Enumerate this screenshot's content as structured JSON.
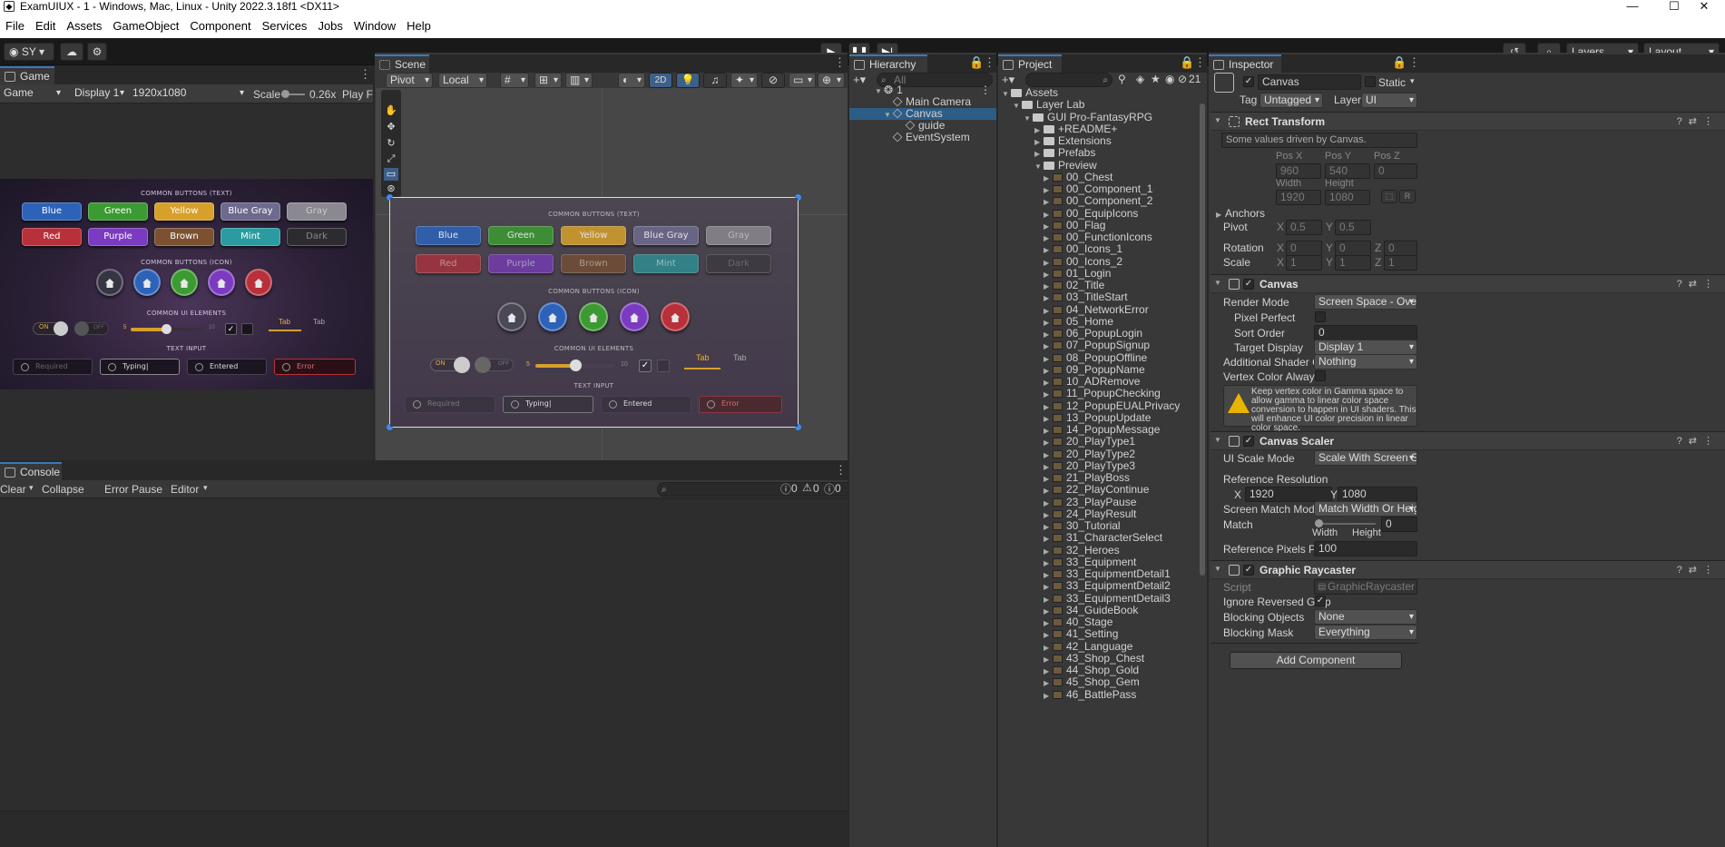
{
  "window": {
    "title": "ExamUIUX - 1 - Windows, Mac, Linux - Unity 2022.3.18f1 <DX11>"
  },
  "menu": [
    "File",
    "Edit",
    "Assets",
    "GameObject",
    "Component",
    "Services",
    "Jobs",
    "Window",
    "Help"
  ],
  "toolbar": {
    "account": "SY",
    "layers": "Layers",
    "layout": "Layout"
  },
  "game": {
    "tab": "Game",
    "mode": "Game",
    "display": "Display 1",
    "resolution": "1920x1080",
    "scale_label": "Scale",
    "scale_value": "0.26x",
    "play_focused": "Play Fc"
  },
  "scene": {
    "tab": "Scene",
    "pivot": "Pivot",
    "local": "Local",
    "mode2d": "2D"
  },
  "ui_canvas": {
    "sec_text": "COMMON BUTTONS (TEXT)",
    "sec_icon": "COMMON BUTTONS (ICON)",
    "sec_elements": "COMMON UI ELEMENTS",
    "sec_input": "TEXT INPUT",
    "buttons_row1": [
      "Blue",
      "Green",
      "Yellow",
      "Blue Gray",
      "Gray"
    ],
    "buttons_row2": [
      "Red",
      "Purple",
      "Brown",
      "Mint",
      "Dark"
    ],
    "toggle_on": "ON",
    "toggle_off": "OFF",
    "slider_min": "5",
    "slider_max": "10",
    "tab_a": "Tab",
    "tab_b": "Tab",
    "inputs": [
      "Required",
      "Typing|",
      "Entered",
      "Error"
    ]
  },
  "hierarchy": {
    "tab": "Hierarchy",
    "search_placeholder": "All",
    "items": [
      {
        "label": "1",
        "depth": 0
      },
      {
        "label": "Main Camera",
        "depth": 1
      },
      {
        "label": "Canvas",
        "depth": 1
      },
      {
        "label": "guide",
        "depth": 2
      },
      {
        "label": "EventSystem",
        "depth": 1
      }
    ]
  },
  "project": {
    "tab": "Project",
    "count": "21",
    "folders": [
      {
        "label": "Assets",
        "depth": 0
      },
      {
        "label": "Layer Lab",
        "depth": 1
      },
      {
        "label": "GUI Pro-FantasyRPG",
        "depth": 2
      },
      {
        "label": "+README+",
        "depth": 3
      },
      {
        "label": "Extensions",
        "depth": 3
      },
      {
        "label": "Prefabs",
        "depth": 3
      },
      {
        "label": "Preview",
        "depth": 3
      }
    ],
    "previews": [
      "00_Chest",
      "00_Component_1",
      "00_Component_2",
      "00_EquipIcons",
      "00_Flag",
      "00_FunctionIcons",
      "00_Icons_1",
      "00_Icons_2",
      "01_Login",
      "02_Title",
      "03_TitleStart",
      "04_NetworkError",
      "05_Home",
      "06_PopupLogin",
      "07_PopupSignup",
      "08_PopupOffline",
      "09_PopupName",
      "10_ADRemove",
      "11_PopupChecking",
      "12_PopupEUALPrivacy",
      "13_PopupUpdate",
      "14_PopupMessage",
      "20_PlayType1",
      "20_PlayType2",
      "20_PlayType3",
      "21_PlayBoss",
      "22_PlayContinue",
      "23_PlayPause",
      "24_PlayResult",
      "30_Tutorial",
      "31_CharacterSelect",
      "32_Heroes",
      "33_Equipment",
      "33_EquipmentDetail1",
      "33_EquipmentDetail2",
      "33_EquipmentDetail3",
      "34_GuideBook",
      "40_Stage",
      "41_Setting",
      "42_Language",
      "43_Shop_Chest",
      "44_Shop_Gold",
      "45_Shop_Gem",
      "46_BattlePass"
    ]
  },
  "console": {
    "tab": "Console",
    "clear": "Clear",
    "collapse": "Collapse",
    "error_pause": "Error Pause",
    "editor": "Editor",
    "count_log": "0",
    "count_warn": "0",
    "count_err": "0"
  },
  "inspector": {
    "tab": "Inspector",
    "object_name": "Canvas",
    "static_label": "Static",
    "tag_label": "Tag",
    "tag_value": "Untagged",
    "layer_label": "Layer",
    "layer_value": "UI",
    "rect_transform": {
      "title": "Rect Transform",
      "note": "Some values driven by Canvas.",
      "pos_x_label": "Pos X",
      "pos_y_label": "Pos Y",
      "pos_z_label": "Pos Z",
      "pos_x": "960",
      "pos_y": "540",
      "pos_z": "0",
      "width_label": "Width",
      "height_label": "Height",
      "width": "1920",
      "height": "1080",
      "anchors": "Anchors",
      "pivot_label": "Pivot",
      "pivot_x": "0.5",
      "pivot_y": "0.5",
      "rotation_label": "Rotation",
      "rot_x": "0",
      "rot_y": "0",
      "rot_z": "0",
      "scale_label": "Scale",
      "scale_x": "1",
      "scale_y": "1",
      "scale_z": "1",
      "x": "X",
      "y": "Y",
      "z": "Z",
      "r": "R"
    },
    "canvas": {
      "title": "Canvas",
      "render_mode_label": "Render Mode",
      "render_mode": "Screen Space - Overl",
      "pixel_perfect_label": "Pixel Perfect",
      "sort_order_label": "Sort Order",
      "sort_order": "0",
      "target_display_label": "Target Display",
      "target_display": "Display 1",
      "shader_label": "Additional Shader Ch",
      "shader": "Nothing",
      "vertex_label": "Vertex Color Always I",
      "warning": "Keep vertex color in Gamma space to allow gamma to linear color space conversion to happen in UI shaders. This will enhance UI color precision in linear color space."
    },
    "scaler": {
      "title": "Canvas Scaler",
      "ui_scale_label": "UI Scale Mode",
      "ui_scale": "Scale With Screen Si",
      "ref_res_label": "Reference Resolution",
      "ref_x": "1920",
      "ref_y": "1080",
      "match_mode_label": "Screen Match Mode",
      "match_mode": "Match Width Or Heigh",
      "match_label": "Match",
      "match_value": "0",
      "width": "Width",
      "height": "Height",
      "ppu_label": "Reference Pixels Per",
      "ppu": "100"
    },
    "raycaster": {
      "title": "Graphic Raycaster",
      "script_label": "Script",
      "script": "GraphicRaycaster",
      "ignore_label": "Ignore Reversed Grap",
      "blocking_objects_label": "Blocking Objects",
      "blocking_objects": "None",
      "blocking_mask_label": "Blocking Mask",
      "blocking_mask": "Everything"
    },
    "add_component": "Add Component"
  },
  "colors": {
    "blue": "#2c63b8",
    "green": "#3c9a32",
    "yellow": "#d6a02b",
    "bluegray": "#6d6a8e",
    "gray": "#8a8890",
    "red": "#b8303a",
    "purple": "#7b3bc0",
    "brown": "#7b5131",
    "mint": "#2a9c9f",
    "dark": "#2c2b30",
    "selection": "#2c5d87",
    "accent": "#3a79bb"
  }
}
